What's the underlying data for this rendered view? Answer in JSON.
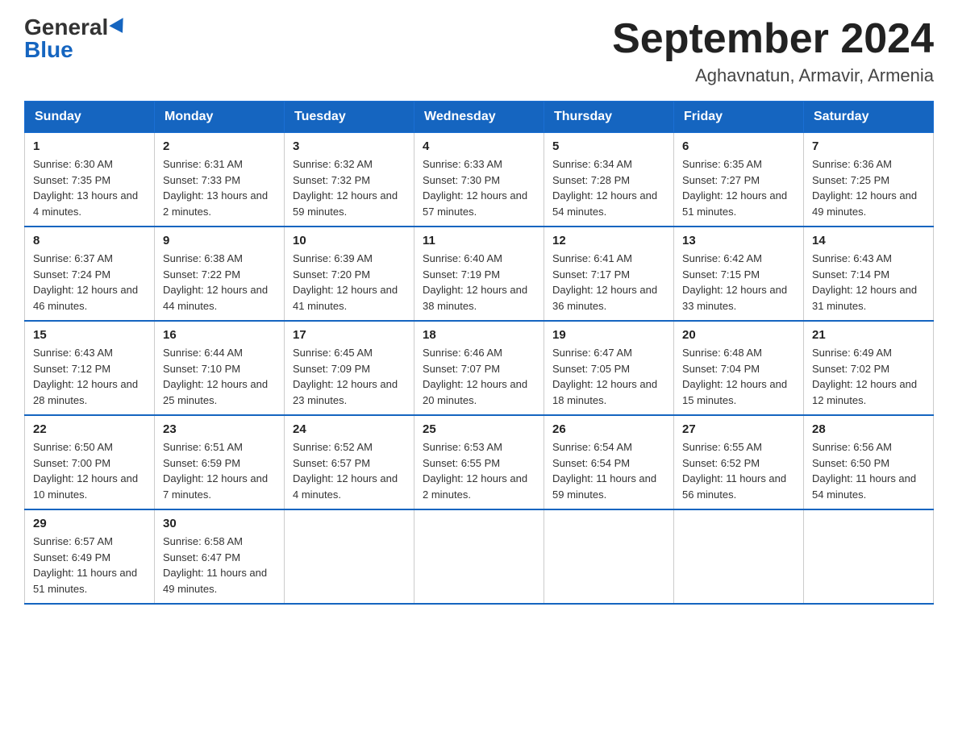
{
  "header": {
    "logo": {
      "general": "General",
      "blue": "Blue"
    },
    "title": "September 2024",
    "subtitle": "Aghavnatun, Armavir, Armenia"
  },
  "weekdays": [
    "Sunday",
    "Monday",
    "Tuesday",
    "Wednesday",
    "Thursday",
    "Friday",
    "Saturday"
  ],
  "weeks": [
    [
      {
        "day": "1",
        "sunrise": "6:30 AM",
        "sunset": "7:35 PM",
        "daylight": "13 hours and 4 minutes."
      },
      {
        "day": "2",
        "sunrise": "6:31 AM",
        "sunset": "7:33 PM",
        "daylight": "13 hours and 2 minutes."
      },
      {
        "day": "3",
        "sunrise": "6:32 AM",
        "sunset": "7:32 PM",
        "daylight": "12 hours and 59 minutes."
      },
      {
        "day": "4",
        "sunrise": "6:33 AM",
        "sunset": "7:30 PM",
        "daylight": "12 hours and 57 minutes."
      },
      {
        "day": "5",
        "sunrise": "6:34 AM",
        "sunset": "7:28 PM",
        "daylight": "12 hours and 54 minutes."
      },
      {
        "day": "6",
        "sunrise": "6:35 AM",
        "sunset": "7:27 PM",
        "daylight": "12 hours and 51 minutes."
      },
      {
        "day": "7",
        "sunrise": "6:36 AM",
        "sunset": "7:25 PM",
        "daylight": "12 hours and 49 minutes."
      }
    ],
    [
      {
        "day": "8",
        "sunrise": "6:37 AM",
        "sunset": "7:24 PM",
        "daylight": "12 hours and 46 minutes."
      },
      {
        "day": "9",
        "sunrise": "6:38 AM",
        "sunset": "7:22 PM",
        "daylight": "12 hours and 44 minutes."
      },
      {
        "day": "10",
        "sunrise": "6:39 AM",
        "sunset": "7:20 PM",
        "daylight": "12 hours and 41 minutes."
      },
      {
        "day": "11",
        "sunrise": "6:40 AM",
        "sunset": "7:19 PM",
        "daylight": "12 hours and 38 minutes."
      },
      {
        "day": "12",
        "sunrise": "6:41 AM",
        "sunset": "7:17 PM",
        "daylight": "12 hours and 36 minutes."
      },
      {
        "day": "13",
        "sunrise": "6:42 AM",
        "sunset": "7:15 PM",
        "daylight": "12 hours and 33 minutes."
      },
      {
        "day": "14",
        "sunrise": "6:43 AM",
        "sunset": "7:14 PM",
        "daylight": "12 hours and 31 minutes."
      }
    ],
    [
      {
        "day": "15",
        "sunrise": "6:43 AM",
        "sunset": "7:12 PM",
        "daylight": "12 hours and 28 minutes."
      },
      {
        "day": "16",
        "sunrise": "6:44 AM",
        "sunset": "7:10 PM",
        "daylight": "12 hours and 25 minutes."
      },
      {
        "day": "17",
        "sunrise": "6:45 AM",
        "sunset": "7:09 PM",
        "daylight": "12 hours and 23 minutes."
      },
      {
        "day": "18",
        "sunrise": "6:46 AM",
        "sunset": "7:07 PM",
        "daylight": "12 hours and 20 minutes."
      },
      {
        "day": "19",
        "sunrise": "6:47 AM",
        "sunset": "7:05 PM",
        "daylight": "12 hours and 18 minutes."
      },
      {
        "day": "20",
        "sunrise": "6:48 AM",
        "sunset": "7:04 PM",
        "daylight": "12 hours and 15 minutes."
      },
      {
        "day": "21",
        "sunrise": "6:49 AM",
        "sunset": "7:02 PM",
        "daylight": "12 hours and 12 minutes."
      }
    ],
    [
      {
        "day": "22",
        "sunrise": "6:50 AM",
        "sunset": "7:00 PM",
        "daylight": "12 hours and 10 minutes."
      },
      {
        "day": "23",
        "sunrise": "6:51 AM",
        "sunset": "6:59 PM",
        "daylight": "12 hours and 7 minutes."
      },
      {
        "day": "24",
        "sunrise": "6:52 AM",
        "sunset": "6:57 PM",
        "daylight": "12 hours and 4 minutes."
      },
      {
        "day": "25",
        "sunrise": "6:53 AM",
        "sunset": "6:55 PM",
        "daylight": "12 hours and 2 minutes."
      },
      {
        "day": "26",
        "sunrise": "6:54 AM",
        "sunset": "6:54 PM",
        "daylight": "11 hours and 59 minutes."
      },
      {
        "day": "27",
        "sunrise": "6:55 AM",
        "sunset": "6:52 PM",
        "daylight": "11 hours and 56 minutes."
      },
      {
        "day": "28",
        "sunrise": "6:56 AM",
        "sunset": "6:50 PM",
        "daylight": "11 hours and 54 minutes."
      }
    ],
    [
      {
        "day": "29",
        "sunrise": "6:57 AM",
        "sunset": "6:49 PM",
        "daylight": "11 hours and 51 minutes."
      },
      {
        "day": "30",
        "sunrise": "6:58 AM",
        "sunset": "6:47 PM",
        "daylight": "11 hours and 49 minutes."
      },
      null,
      null,
      null,
      null,
      null
    ]
  ]
}
